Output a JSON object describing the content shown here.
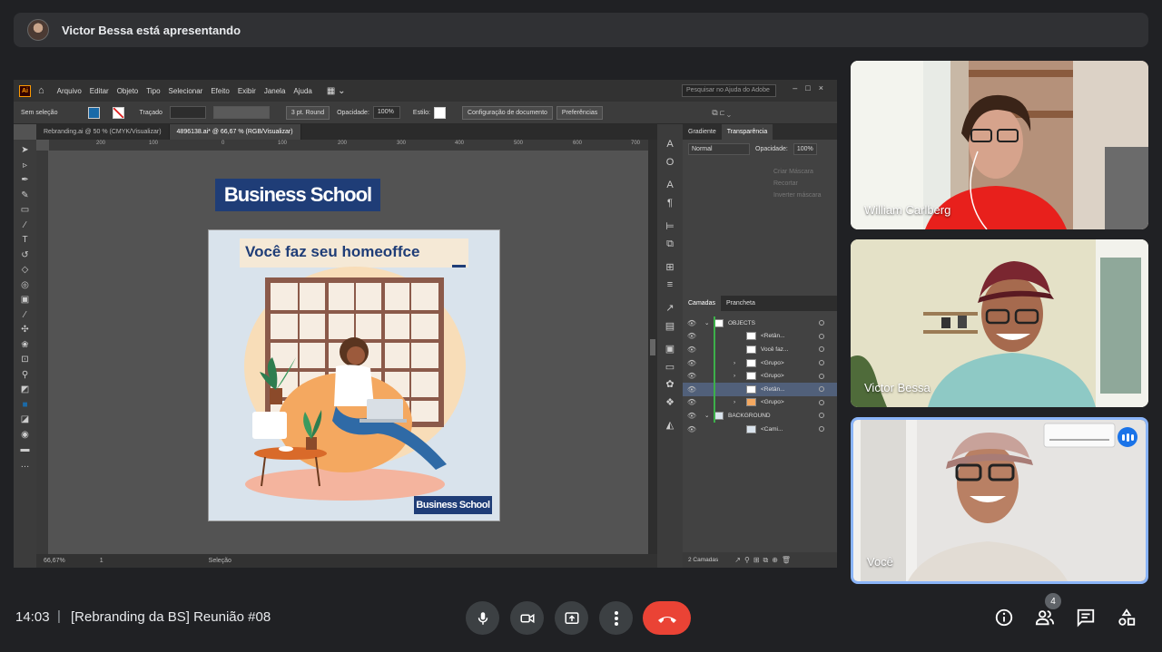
{
  "presenter_banner": {
    "text": "Victor Bessa está apresentando"
  },
  "illustrator": {
    "menu": [
      "Arquivo",
      "Editar",
      "Objeto",
      "Tipo",
      "Selecionar",
      "Efeito",
      "Exibir",
      "Janela",
      "Ajuda"
    ],
    "search_placeholder": "Pesquisar no Ajuda do Adobe",
    "control_bar": {
      "selection": "Sem seleção",
      "stroke_label": "Traçado",
      "brush": "3 pt. Round",
      "opacity_label": "Opacidade:",
      "opacity_value": "100%",
      "style_label": "Estilo:",
      "doc_setup": "Configuração de documento",
      "preferences": "Preferências"
    },
    "tabs": [
      "Rebranding.ai @ 50 % (CMYK/Visualizar)",
      "4896138.ai* @ 66,67 % (RGB/Visualizar)"
    ],
    "ruler_marks": [
      "200",
      "100",
      "0",
      "100",
      "200",
      "300",
      "400",
      "500",
      "600",
      "700"
    ],
    "status": {
      "zoom": "66,67%",
      "page": "1",
      "tool": "Seleção"
    },
    "panels": {
      "top_tabs": [
        "Gradiente",
        "Transparência"
      ],
      "blend_mode": "Normal",
      "opacity_label": "Opacidade:",
      "opacity_value": "100%",
      "ghost_lines": [
        "Criar Máscara",
        "Recortar",
        "Inverter máscara"
      ],
      "layer_tabs": [
        "Camadas",
        "Prancheta"
      ],
      "layers": [
        {
          "name": "OBJECTS",
          "indent": 0,
          "arrow": "⌄",
          "selected": false
        },
        {
          "name": "<Retân...",
          "indent": 1,
          "arrow": "",
          "selected": false
        },
        {
          "name": "Você faz...",
          "indent": 1,
          "arrow": "",
          "selected": false
        },
        {
          "name": "<Grupo>",
          "indent": 1,
          "arrow": "›",
          "selected": false
        },
        {
          "name": "<Grupo>",
          "indent": 1,
          "arrow": "›",
          "selected": false
        },
        {
          "name": "<Retân...",
          "indent": 1,
          "arrow": "",
          "selected": true
        },
        {
          "name": "<Grupo>",
          "indent": 1,
          "arrow": "›",
          "selected": false
        },
        {
          "name": "BACKGROUND",
          "indent": 0,
          "arrow": "⌄",
          "selected": false
        },
        {
          "name": "<Cami...",
          "indent": 1,
          "arrow": "",
          "selected": false
        }
      ],
      "layer_count": "2 Camadas"
    },
    "artwork": {
      "logo_top": "Business School",
      "headline": "Você faz seu homeoffce",
      "logo_bottom": "Business School"
    }
  },
  "participants": [
    {
      "name": "William Carlberg"
    },
    {
      "name": "Victor Bessa"
    },
    {
      "name": "Você"
    }
  ],
  "bottom_bar": {
    "time": "14:03",
    "separator": "|",
    "meeting_title": "[Rebranding da BS] Reunião #08",
    "people_count": "4"
  },
  "colors": {
    "end_call": "#ea4335",
    "speaking_border": "#8ab4f8",
    "brand_blue": "#1f3d77"
  }
}
